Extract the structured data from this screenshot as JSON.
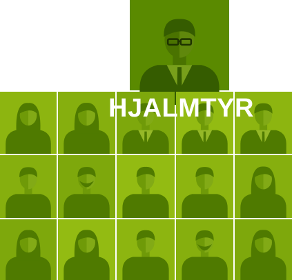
{
  "title": "HJALMTYR",
  "colors": {
    "background": "#ffffff",
    "featured_tile": "#5a8a00",
    "tile_shades": [
      "#8db510",
      "#86af0e",
      "#7ea80c",
      "#93bb12"
    ],
    "silhouette_dark": "#4f7a00",
    "silhouette_mid": "#6f9a08",
    "silhouette_light": "#a6c832",
    "title_text": "#ffffff"
  },
  "tiles": [
    {
      "row": 0,
      "col": 0,
      "figure": "woman-long-hair"
    },
    {
      "row": 0,
      "col": 1,
      "figure": "woman-long-hair"
    },
    {
      "row": 0,
      "col": 2,
      "figure": "man-suit"
    },
    {
      "row": 0,
      "col": 3,
      "figure": "man-suit"
    },
    {
      "row": 0,
      "col": 4,
      "figure": "man-suit"
    },
    {
      "row": 1,
      "col": 0,
      "figure": "man-casual"
    },
    {
      "row": 1,
      "col": 1,
      "figure": "man-beard"
    },
    {
      "row": 1,
      "col": 2,
      "figure": "woman-short-hair"
    },
    {
      "row": 1,
      "col": 3,
      "figure": "man-casual"
    },
    {
      "row": 1,
      "col": 4,
      "figure": "woman-curly-hair"
    },
    {
      "row": 2,
      "col": 0,
      "figure": "woman-long-hair"
    },
    {
      "row": 2,
      "col": 1,
      "figure": "woman-long-hair"
    },
    {
      "row": 2,
      "col": 2,
      "figure": "woman-short-hair"
    },
    {
      "row": 2,
      "col": 3,
      "figure": "man-beard"
    },
    {
      "row": 2,
      "col": 4,
      "figure": "woman-curly-hair"
    }
  ],
  "featured": {
    "figure": "man-glasses-suit"
  }
}
